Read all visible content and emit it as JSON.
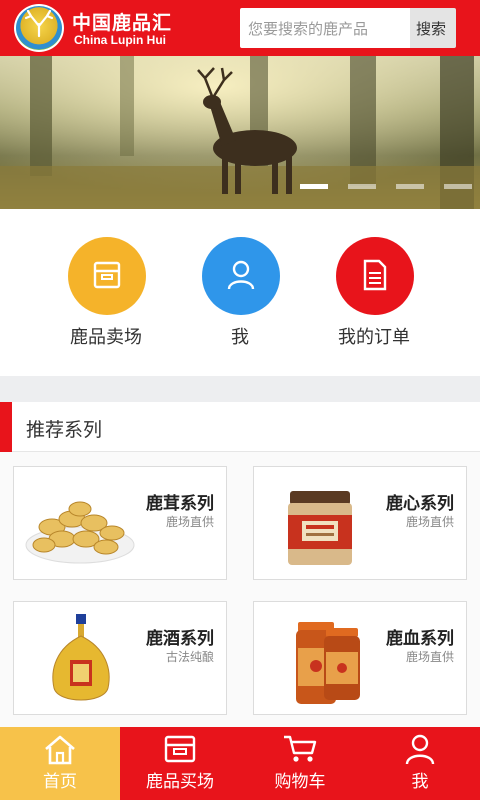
{
  "header": {
    "brand_cn": "中国鹿品汇",
    "brand_en": "China Lupin Hui",
    "search_placeholder": "您要搜索的鹿产品",
    "search_button": "搜索"
  },
  "banner": {
    "slides_count": 4,
    "active_slide": 1
  },
  "quick_menu": [
    {
      "label": "鹿品卖场",
      "color": "#f5b32a",
      "icon": "store-icon"
    },
    {
      "label": "我",
      "color": "#2f96ea",
      "icon": "user-icon"
    },
    {
      "label": "我的订单",
      "color": "#e8141b",
      "icon": "document-icon"
    }
  ],
  "section": {
    "title": "推荐系列"
  },
  "products": [
    {
      "title": "鹿茸系列",
      "subtitle": "鹿场直供",
      "image": "antler-slices"
    },
    {
      "title": "鹿心系列",
      "subtitle": "鹿场直供",
      "image": "jar"
    },
    {
      "title": "鹿酒系列",
      "subtitle": "古法纯酿",
      "image": "liquor-bottle"
    },
    {
      "title": "鹿血系列",
      "subtitle": "鹿场直供",
      "image": "capsule-bottles"
    }
  ],
  "bottom_nav": [
    {
      "label": "首页",
      "icon": "home-icon",
      "active": true
    },
    {
      "label": "鹿品买场",
      "icon": "store-icon",
      "active": false
    },
    {
      "label": "购物车",
      "icon": "cart-icon",
      "active": false
    },
    {
      "label": "我",
      "icon": "user-icon",
      "active": false
    }
  ],
  "colors": {
    "brand_red": "#e8141b",
    "active_tab": "#f7c24a"
  }
}
